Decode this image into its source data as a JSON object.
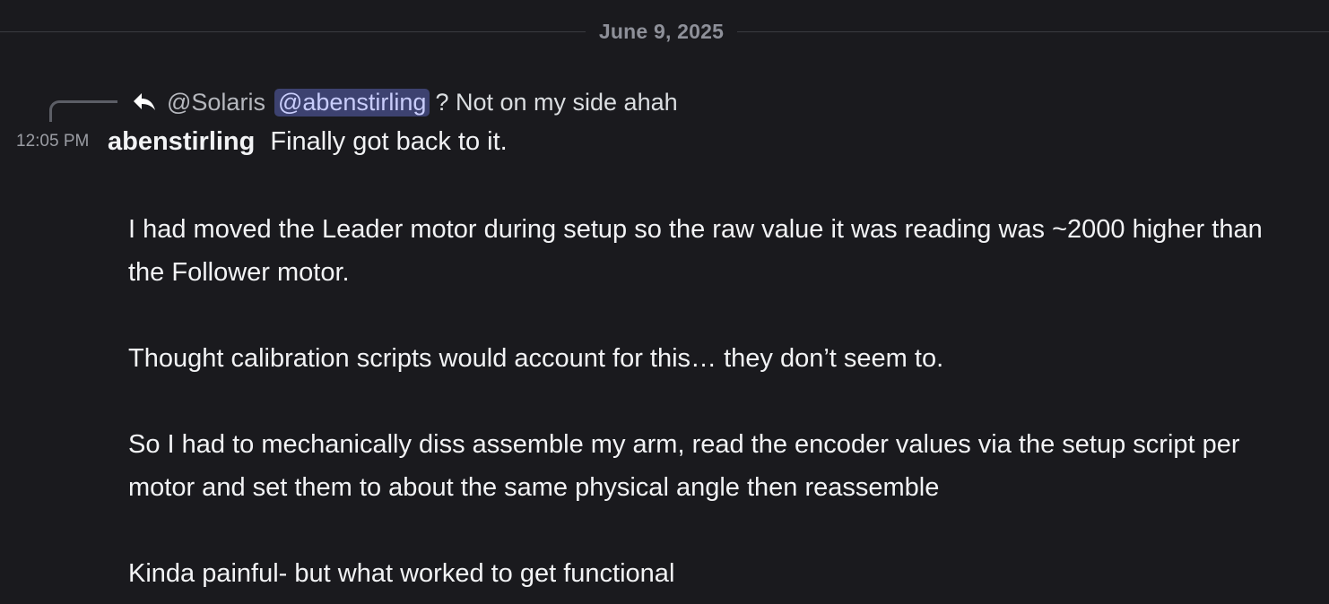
{
  "date_divider": "June 9, 2025",
  "reply": {
    "author": "@Solaris",
    "mention": "@abenstirling",
    "text": "? Not on my side ahah"
  },
  "message": {
    "timestamp": "12:05 PM",
    "author": "abenstirling",
    "first_line": "Finally got back to it.",
    "paragraphs": [
      "I had moved the Leader motor during setup so the raw value it was reading was ~2000 higher than the Follower motor.",
      "Thought calibration scripts would account for this… they don’t seem to.",
      "So I had to mechanically diss assemble my arm, read the encoder values via the setup script per motor and set them to about the same physical angle then reassemble",
      "Kinda painful- but what worked to get functional"
    ]
  },
  "icons": {
    "reply": "reply-arrow-icon"
  },
  "colors": {
    "background": "#1a1a1e",
    "mention_bg": "#3d4270",
    "mention_text": "#c9cdfb",
    "text": "#f2f3f5",
    "muted": "#8e9099"
  }
}
